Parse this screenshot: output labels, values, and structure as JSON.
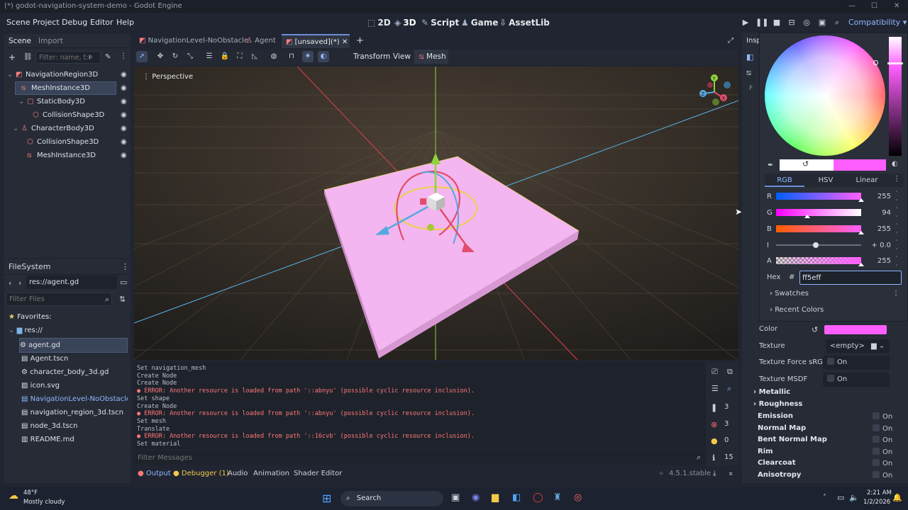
{
  "window": {
    "title": "(*) godot-navigation-system-demo - Godot Engine"
  },
  "menu": [
    "Scene",
    "Project",
    "Debug",
    "Editor",
    "Help"
  ],
  "modes": [
    {
      "icon": "2d-icon",
      "label": "2D"
    },
    {
      "icon": "3d-icon",
      "label": "3D"
    },
    {
      "icon": "script-icon",
      "label": "Script"
    },
    {
      "icon": "game-icon",
      "label": "Game"
    },
    {
      "icon": "assetlib-icon",
      "label": "AssetLib"
    }
  ],
  "renderer": "Compatibility",
  "scene_dock": {
    "tabs": [
      "Scene",
      "Import"
    ],
    "filter_placeholder": "Filter: name, t:t",
    "nodes": [
      {
        "label": "NavigationRegion3D",
        "icon": "navigation-region-icon",
        "selected": false
      },
      {
        "label": "MeshInstance3D",
        "icon": "mesh-instance-icon",
        "selected": true
      },
      {
        "label": "StaticBody3D",
        "icon": "static-body-icon",
        "selected": false
      },
      {
        "label": "CollisionShape3D",
        "icon": "collision-shape-icon",
        "selected": false
      },
      {
        "label": "CharacterBody3D",
        "icon": "character-body-icon",
        "selected": false
      },
      {
        "label": "CollisionShape3D",
        "icon": "collision-shape-icon",
        "selected": false
      },
      {
        "label": "MeshInstance3D",
        "icon": "mesh-instance-icon",
        "selected": false
      }
    ]
  },
  "filesystem": {
    "title": "FileSystem",
    "path": "res://agent.gd",
    "filter_placeholder": "Filter Files",
    "favorites": "Favorites:",
    "root": "res://",
    "files": [
      {
        "name": "agent.gd",
        "icon": "gear-icon",
        "selected": true
      },
      {
        "name": "Agent.tscn",
        "icon": "scene-icon",
        "selected": false
      },
      {
        "name": "character_body_3d.gd",
        "icon": "gear-icon",
        "selected": false
      },
      {
        "name": "icon.svg",
        "icon": "image-icon",
        "selected": false
      },
      {
        "name": "NavigationLevel-NoObstacle...",
        "icon": "scene-icon",
        "selected": false,
        "highlight": true
      },
      {
        "name": "navigation_region_3d.tscn",
        "icon": "scene-icon",
        "selected": false
      },
      {
        "name": "node_3d.tscn",
        "icon": "scene-icon",
        "selected": false
      },
      {
        "name": "README.md",
        "icon": "doc-icon",
        "selected": false
      }
    ]
  },
  "editor_tabs": [
    {
      "label": "NavigationLevel-NoObstacle",
      "active": false
    },
    {
      "label": "Agent",
      "active": false
    },
    {
      "label": "[unsaved](*)",
      "active": true
    }
  ],
  "viewport_toolbar": {
    "transform": "Transform",
    "view": "View",
    "mesh": "Mesh"
  },
  "viewport": {
    "label": "Perspective"
  },
  "console": {
    "lines": [
      {
        "text": "Set navigation_mesh",
        "error": false
      },
      {
        "text": "Create Node",
        "error": false
      },
      {
        "text": "Create Node",
        "error": false
      },
      {
        "text": "ERROR: Another resource is loaded from path '::abnyu' (possible cyclic resource inclusion).",
        "error": true
      },
      {
        "text": "Set shape",
        "error": false
      },
      {
        "text": "Create Node",
        "error": false
      },
      {
        "text": "ERROR: Another resource is loaded from path '::abnyu' (possible cyclic resource inclusion).",
        "error": true
      },
      {
        "text": "Set mesh",
        "error": false
      },
      {
        "text": "Translate",
        "error": false
      },
      {
        "text": "ERROR: Another resource is loaded from path '::16cvb' (possible cyclic resource inclusion).",
        "error": true
      },
      {
        "text": "Set material",
        "error": false
      }
    ],
    "filter_placeholder": "Filter Messages",
    "counts": {
      "messages": "3",
      "errors": "3",
      "warnings": "0",
      "info": "15"
    }
  },
  "bottom_tabs": [
    "Output",
    "Debugger (1)",
    "Audio",
    "Animation",
    "Shader Editor"
  ],
  "version": "4.5.1.stable",
  "inspector": {
    "tab": "Insp",
    "properties": [
      {
        "label": "Color",
        "type": "color",
        "value": "#ff5eff"
      },
      {
        "label": "Texture",
        "type": "resource",
        "value": "<empty>"
      },
      {
        "label": "Texture Force sRGB",
        "type": "check",
        "value": "On"
      },
      {
        "label": "Texture MSDF",
        "type": "check",
        "value": "On"
      }
    ],
    "sections": [
      {
        "label": "Metallic",
        "on": ""
      },
      {
        "label": "Roughness",
        "on": ""
      },
      {
        "label": "Emission",
        "on": "On"
      },
      {
        "label": "Normal Map",
        "on": "On"
      },
      {
        "label": "Bent Normal Map",
        "on": "On"
      },
      {
        "label": "Rim",
        "on": "On"
      },
      {
        "label": "Clearcoat",
        "on": "On"
      },
      {
        "label": "Anisotropy",
        "on": "On"
      }
    ]
  },
  "color_picker": {
    "modes": [
      "RGB",
      "HSV",
      "Linear"
    ],
    "active_mode": "RGB",
    "channels": [
      {
        "name": "R",
        "value": "255",
        "fraction": 1.0
      },
      {
        "name": "G",
        "value": "94",
        "fraction": 0.37
      },
      {
        "name": "B",
        "value": "255",
        "fraction": 1.0
      },
      {
        "name": "I",
        "value": "+ 0.0",
        "fraction": 0.5
      },
      {
        "name": "A",
        "value": "255",
        "fraction": 1.0
      }
    ],
    "hex_label": "Hex",
    "hash": "#",
    "hex": "ff5eff",
    "swatches": "Swatches",
    "recent": "Recent Colors",
    "current_color": "#ff5eff"
  },
  "taskbar": {
    "weather_temp": "48°F",
    "weather_desc": "Mostly cloudy",
    "search": "Search",
    "time": "2:21 AM",
    "date": "1/2/2026"
  }
}
